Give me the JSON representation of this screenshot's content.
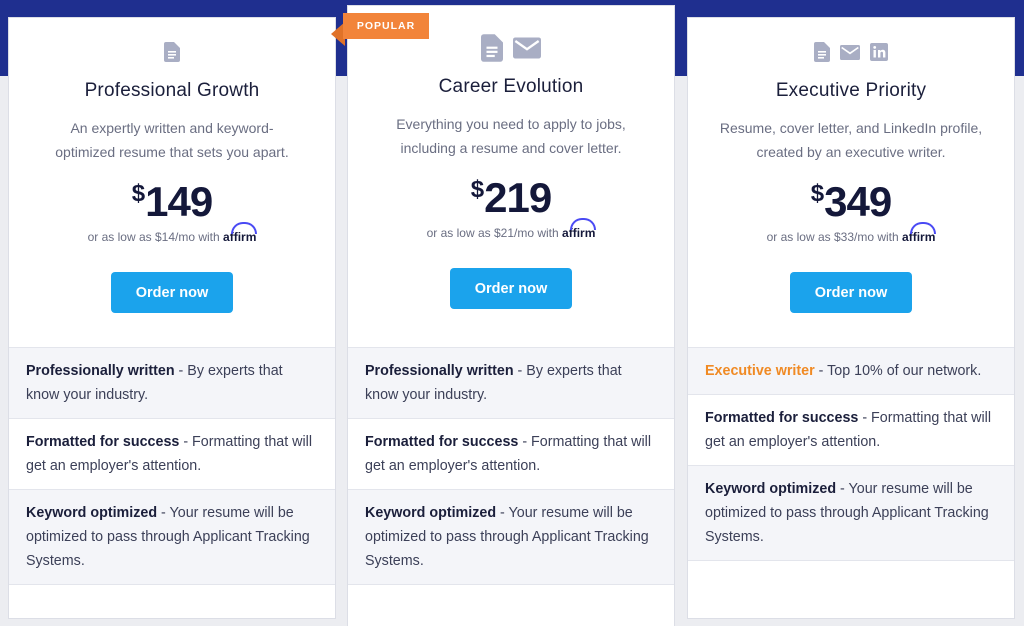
{
  "colors": {
    "band": "#1f2f8f",
    "button": "#1ba3ec",
    "ribbon": "#f2843a",
    "accent_orange": "#f08a24"
  },
  "ribbon": {
    "label": "POPULAR"
  },
  "plans": [
    {
      "icons": [
        "document-icon"
      ],
      "title": "Professional Growth",
      "desc_1": "An expertly written and keyword-",
      "desc_2": "optimized resume that sets you apart.",
      "currency": "$",
      "price": "149",
      "affirm_text": "or as low as $14/mo with",
      "affirm_brand": "affirm",
      "button": "Order now",
      "features": [
        {
          "bold": "Professionally written",
          "text": " - By experts that know your industry."
        },
        {
          "bold": "Formatted for success",
          "text": " - Formatting that will get an employer's attention."
        },
        {
          "bold": "Keyword optimized",
          "text": " - Your resume will be optimized to pass through Applicant Tracking Systems."
        }
      ]
    },
    {
      "icons": [
        "document-icon",
        "mail-icon"
      ],
      "title": "Career Evolution",
      "desc_1": "Everything you need to apply to jobs,",
      "desc_2": "including a resume and cover letter.",
      "currency": "$",
      "price": "219",
      "affirm_text": "or as low as $21/mo with",
      "affirm_brand": "affirm",
      "button": "Order now",
      "features": [
        {
          "bold": "Professionally written",
          "text": " - By experts that know your industry."
        },
        {
          "bold": "Formatted for success",
          "text": " - Formatting that will get an employer's attention."
        },
        {
          "bold": "Keyword optimized",
          "text": " - Your resume will be optimized to pass through Applicant Tracking Systems."
        }
      ]
    },
    {
      "icons": [
        "document-icon",
        "mail-icon",
        "linkedin-icon"
      ],
      "title": "Executive Priority",
      "desc_1": "Resume, cover letter, and LinkedIn profile,",
      "desc_2": "created by an executive writer.",
      "currency": "$",
      "price": "349",
      "affirm_text": "or as low as $33/mo with",
      "affirm_brand": "affirm",
      "button": "Order now",
      "features": [
        {
          "bold": "Executive writer",
          "text": " - Top 10% of our network."
        },
        {
          "bold": "Formatted for success",
          "text": " - Formatting that will get an employer's attention."
        },
        {
          "bold": "Keyword optimized",
          "text": " - Your resume will be optimized to pass through Applicant Tracking Systems."
        }
      ]
    }
  ]
}
